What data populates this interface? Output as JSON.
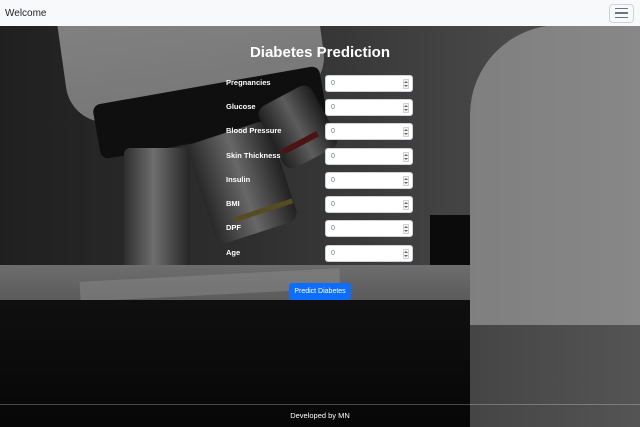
{
  "navbar": {
    "brand": "Welcome",
    "toggler_icon": "hamburger-menu-icon"
  },
  "form": {
    "title": "Diabetes Prediction",
    "fields": [
      {
        "label": "Pregnancies",
        "value": "0"
      },
      {
        "label": "Glucose",
        "value": "0"
      },
      {
        "label": "Blood Pressure",
        "value": "0"
      },
      {
        "label": "Skin Thickness",
        "value": "0"
      },
      {
        "label": "Insulin",
        "value": "0"
      },
      {
        "label": "BMI",
        "value": "0"
      },
      {
        "label": "DPF",
        "value": "0"
      },
      {
        "label": "Age",
        "value": "0"
      }
    ],
    "submit_label": "Predict Diabetes"
  },
  "footer": {
    "text": "Developed by MN"
  },
  "colors": {
    "navbar_bg": "#f8f9fa",
    "primary": "#0d6efd",
    "text_light": "#ffffff"
  }
}
